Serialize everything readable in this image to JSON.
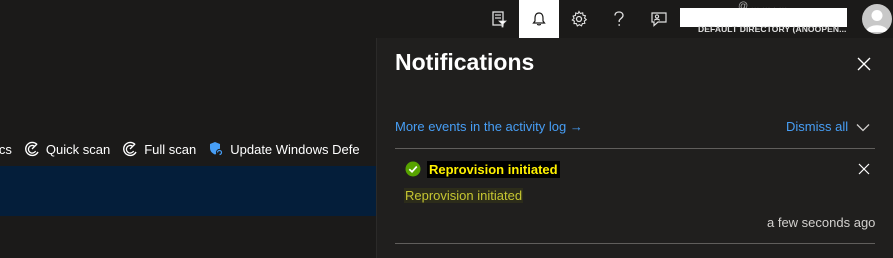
{
  "topbar": {
    "icons": [
      "cloud-shell-filter-icon",
      "bell-icon",
      "gear-icon",
      "help-icon",
      "feedback-icon"
    ],
    "active_icon": "bell-icon",
    "account": {
      "email_partial": "@ ... ... . ...",
      "directory": "DEFAULT DIRECTORY (ANOOPEN..."
    }
  },
  "command_bar": {
    "items": [
      {
        "label": "ics",
        "icon": ""
      },
      {
        "label": "Quick scan",
        "icon": "scan-icon"
      },
      {
        "label": "Full scan",
        "icon": "scan-icon"
      },
      {
        "label": "Update Windows Defe",
        "icon": "shield-update-icon"
      }
    ]
  },
  "notifications": {
    "title": "Notifications",
    "activity_link": "More events in the activity log",
    "activity_arrow": "→",
    "dismiss_all": "Dismiss all",
    "items": [
      {
        "title": "Reprovision initiated",
        "body": "Reprovision initiated",
        "time": "a few seconds ago",
        "status": "success",
        "status_color": "#57a300"
      }
    ]
  },
  "colors": {
    "background": "#1b1a19",
    "panel": "#201f1e",
    "link": "#479ef5",
    "highlight_text": "#fff100",
    "blue_band": "#041e3a"
  }
}
